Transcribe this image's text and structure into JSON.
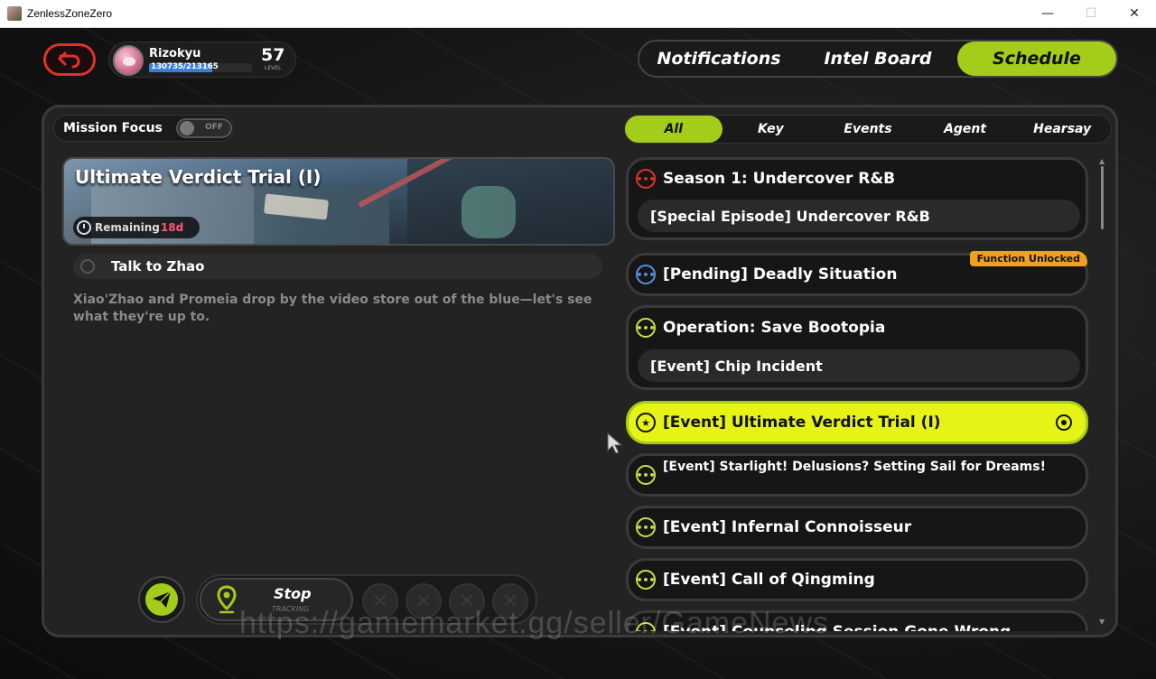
{
  "window": {
    "title": "ZenlessZoneZero",
    "controls": [
      "minimize",
      "maximize",
      "close"
    ]
  },
  "profile": {
    "name": "Rizokyu",
    "exp": "130735/213165",
    "exp_fraction": 0.613,
    "level": "57",
    "level_label": "LEVEL"
  },
  "top_tabs": [
    {
      "label": "Notifications",
      "active": false
    },
    {
      "label": "Intel Board",
      "active": false
    },
    {
      "label": "Schedule",
      "active": true
    }
  ],
  "mission_focus": {
    "label": "Mission Focus",
    "toggle": "OFF"
  },
  "detail": {
    "title": "Ultimate Verdict Trial (I)",
    "remaining_label": "Remaining",
    "remaining_value": "18d",
    "objective": "Talk to Zhao",
    "description": "Xiao'Zhao and Promeia drop by the video store out of the blue—let's see what they're up to."
  },
  "tracking": {
    "stop_label": "Stop",
    "stop_sub": "TRACKING"
  },
  "filters": [
    {
      "label": "All",
      "active": true
    },
    {
      "label": "Key",
      "active": false
    },
    {
      "label": "Events",
      "active": false
    },
    {
      "label": "Agent",
      "active": false
    },
    {
      "label": "Hearsay",
      "active": false
    }
  ],
  "quests": [
    {
      "title": "Season 1: Undercover R&B",
      "icon": "dots-icon",
      "icon_color": "#e0322b",
      "sub": "[Special Episode] Undercover R&B"
    },
    {
      "title": "[Pending] Deadly Situation",
      "icon": "dots-icon",
      "icon_color": "#5a8ee6",
      "badge": "Function Unlocked"
    },
    {
      "title": "Operation: Save Bootopia",
      "icon": "dots-icon",
      "icon_color": "#c8e04a",
      "sub": "[Event] Chip Incident"
    },
    {
      "title": "[Event] Ultimate Verdict Trial (I)",
      "icon": "star-icon",
      "icon_color": "#1a1a1a",
      "highlight": true
    },
    {
      "title": "[Event] Starlight! Delusions? Setting Sail for Dreams!",
      "icon": "dots-icon",
      "icon_color": "#c8e04a"
    },
    {
      "title": "[Event] Infernal Connoisseur",
      "icon": "dots-icon",
      "icon_color": "#c8e04a"
    },
    {
      "title": "[Event] Call of Qingming",
      "icon": "dots-icon",
      "icon_color": "#c8e04a"
    },
    {
      "title": "[Event] Counseling Session Gone Wrong",
      "icon": "dots-icon",
      "icon_color": "#c8e04a"
    }
  ],
  "watermark": "https://gamemarket.gg/seller/GameNews",
  "colors": {
    "accent": "#a4cc1a",
    "highlight": "#e6f316",
    "back": "#e0322b",
    "badge": "#f0a020",
    "remaining": "#ff5577"
  }
}
